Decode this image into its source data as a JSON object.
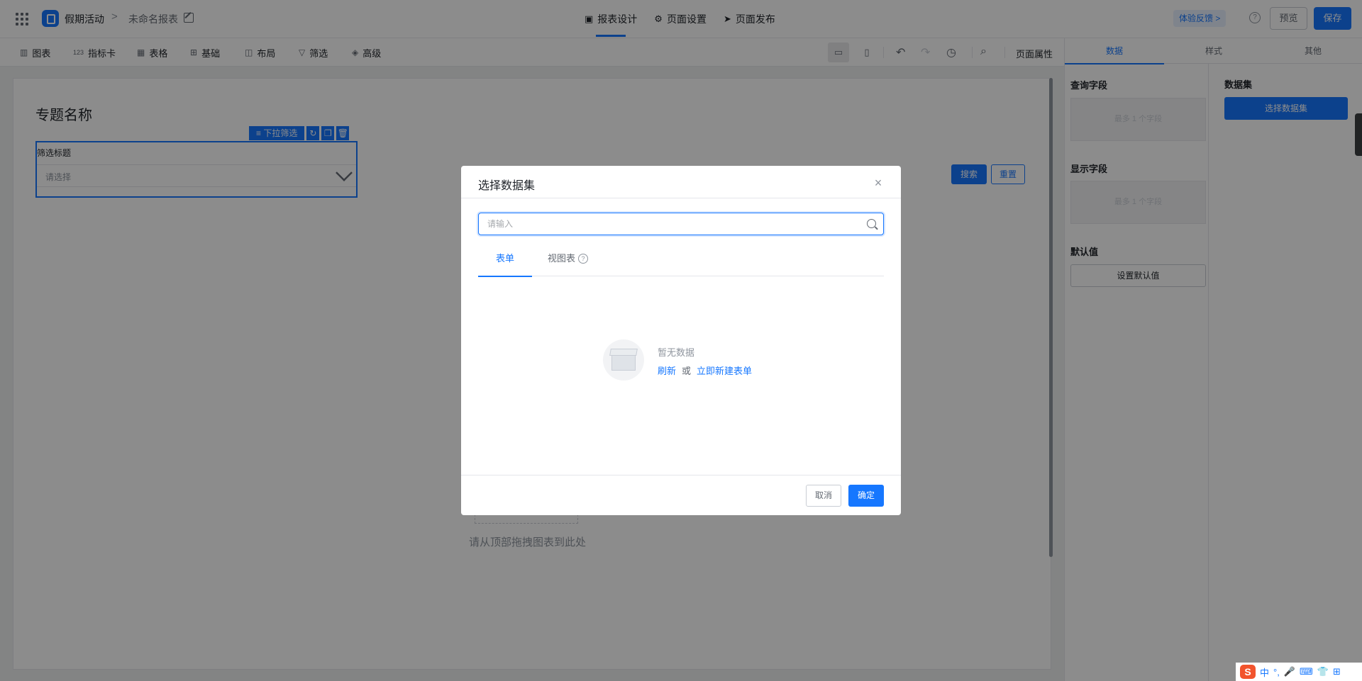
{
  "header": {
    "app_name": "假期活动",
    "breadcrumb_sep": ">",
    "report_name": "未命名报表",
    "tabs": [
      {
        "icon": "report-design-icon",
        "label": "报表设计",
        "active": true
      },
      {
        "icon": "gear-icon",
        "label": "页面设置",
        "active": false
      },
      {
        "icon": "send-icon",
        "label": "页面发布",
        "active": false
      }
    ],
    "feedback_label": "体验反馈 >",
    "help_icon": "?",
    "preview_label": "预览",
    "save_label": "保存"
  },
  "toolbar": {
    "items": [
      {
        "icon": "bar-chart-icon",
        "glyph": "📊",
        "label": "图表"
      },
      {
        "icon": "number-card-icon",
        "glyph": "123",
        "label": "指标卡"
      },
      {
        "icon": "table-icon",
        "glyph": "▦",
        "label": "表格"
      },
      {
        "icon": "basic-icon",
        "glyph": "⊞",
        "label": "基础"
      },
      {
        "icon": "layout-icon",
        "glyph": "◫",
        "label": "布局"
      },
      {
        "icon": "filter-icon",
        "glyph": "▽",
        "label": "筛选"
      },
      {
        "icon": "layers-icon",
        "glyph": "◈",
        "label": "高级"
      }
    ],
    "page_props_label": "页面属性"
  },
  "canvas": {
    "title": "专题名称",
    "filter_toolbar_label": "下拉筛选",
    "filter_title": "筛选标题",
    "filter_placeholder": "请选择",
    "search_label": "搜索",
    "reset_label": "重置",
    "drop_hint": "请从顶部拖拽图表到此处"
  },
  "right_panel": {
    "tabs": [
      {
        "label": "数据",
        "active": true
      },
      {
        "label": "样式",
        "active": false
      },
      {
        "label": "其他",
        "active": false
      }
    ],
    "query_fields_title": "查询字段",
    "query_fields_hint": "最多 1 个字段",
    "display_fields_title": "显示字段",
    "display_fields_hint": "最多 1 个字段",
    "default_value_title": "默认值",
    "set_default_label": "设置默认值",
    "dataset_title": "数据集",
    "choose_dataset_label": "选择数据集"
  },
  "modal": {
    "title": "选择数据集",
    "close": "×",
    "search_placeholder": "请输入",
    "tabs": [
      {
        "label": "表单",
        "active": true
      },
      {
        "label": "视图表",
        "active": false
      }
    ],
    "empty_text": "暂无数据",
    "refresh_link": "刷新",
    "or_text": "或",
    "create_link": "立即新建表单",
    "cancel_label": "取消",
    "ok_label": "确定"
  },
  "ime": {
    "logo": "S",
    "items": [
      "中",
      "°,",
      "🎤",
      "⌨",
      "👕",
      "⊞"
    ]
  },
  "colors": {
    "primary": "#1677ff",
    "overlay": "rgba(0,0,0,0.45)"
  }
}
